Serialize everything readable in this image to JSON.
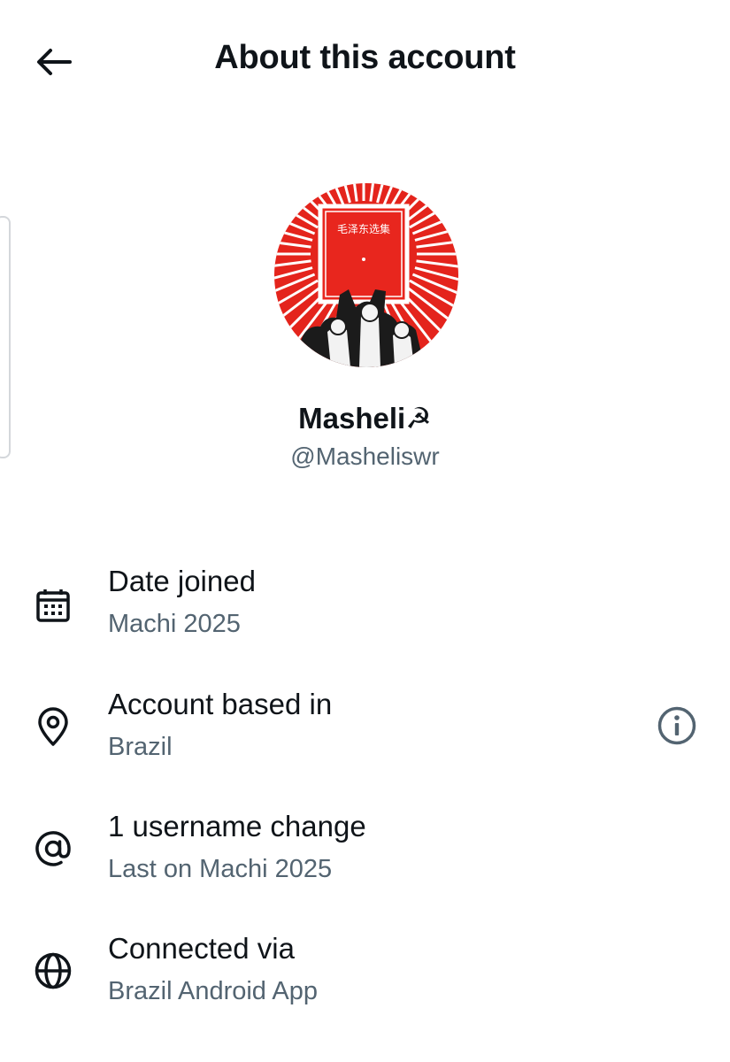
{
  "header": {
    "title": "About this account",
    "back_icon": "arrow-left-icon"
  },
  "profile": {
    "display_name": "Masheli☭",
    "handle": "@Masheliswr",
    "avatar_book_text": "毛泽东选集",
    "avatar_colors": {
      "background": "#e4241c",
      "rays": "#ffffff",
      "book": "#e8261e"
    }
  },
  "rows": [
    {
      "icon": "calendar-icon",
      "title": "Date joined",
      "subtitle": "Machi 2025"
    },
    {
      "icon": "location-pin-icon",
      "title": "Account based in",
      "subtitle": "Brazil",
      "action_icon": "info-icon"
    },
    {
      "icon": "at-sign-icon",
      "title": "1 username change",
      "subtitle": "Last on Machi 2025"
    },
    {
      "icon": "globe-icon",
      "title": "Connected via",
      "subtitle": "Brazil Android App"
    }
  ],
  "colors": {
    "text_primary": "#0f1419",
    "text_secondary": "#536471",
    "background": "#ffffff"
  }
}
